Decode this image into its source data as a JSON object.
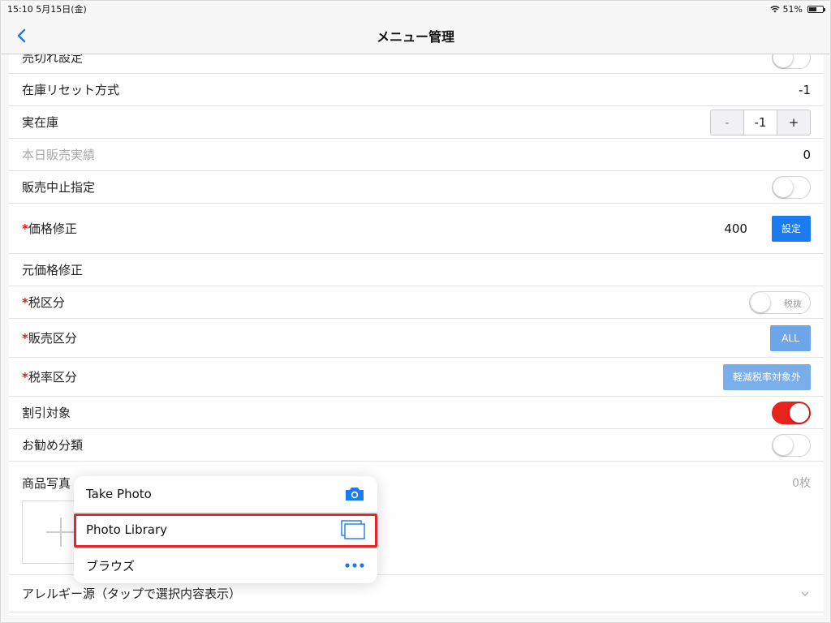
{
  "status_bar": {
    "time_date": "15:10  5月15日(金)",
    "battery": "51%",
    "battery_level": 0.51
  },
  "nav": {
    "title": "メニュー管理"
  },
  "rows": {
    "sold_out": {
      "label": "売切れ設定",
      "on": false
    },
    "stock_reset": {
      "label": "在庫リセット方式",
      "value": "-1"
    },
    "actual_stock": {
      "label": "実在庫",
      "minus": "-",
      "value": "-1",
      "plus": "+"
    },
    "today_sales": {
      "label": "本日販売実績",
      "value": "0"
    },
    "stop_sale": {
      "label": "販売中止指定",
      "on": false
    },
    "price": {
      "required": "*",
      "label": "価格修正",
      "value": "400",
      "button": "設定"
    },
    "original_price": {
      "label": "元価格修正"
    },
    "tax_type": {
      "required": "*",
      "label": "税区分",
      "switch_text": "税抜",
      "on": false
    },
    "sales_type": {
      "required": "*",
      "label": "販売区分",
      "button": "ALL"
    },
    "tax_rate": {
      "required": "*",
      "label": "税率区分",
      "button": "軽減税率対象外"
    },
    "discount": {
      "label": "割引対象",
      "on": true
    },
    "recommend": {
      "label": "お勧め分類",
      "on": false
    },
    "photo": {
      "label": "商品写真",
      "count": "0枚"
    },
    "allergy": {
      "label": "アレルギー源（タップで選択内容表示）"
    }
  },
  "popover": {
    "items": [
      {
        "label": "Take Photo",
        "icon": "camera-icon"
      },
      {
        "label": "Photo Library",
        "icon": "photo-library-icon"
      },
      {
        "label": "ブラウズ",
        "icon": "more-dots-icon"
      }
    ]
  },
  "colors": {
    "accent": "#1a7cf0",
    "switch_on": "#e8231e",
    "highlight": "#e5262b"
  }
}
